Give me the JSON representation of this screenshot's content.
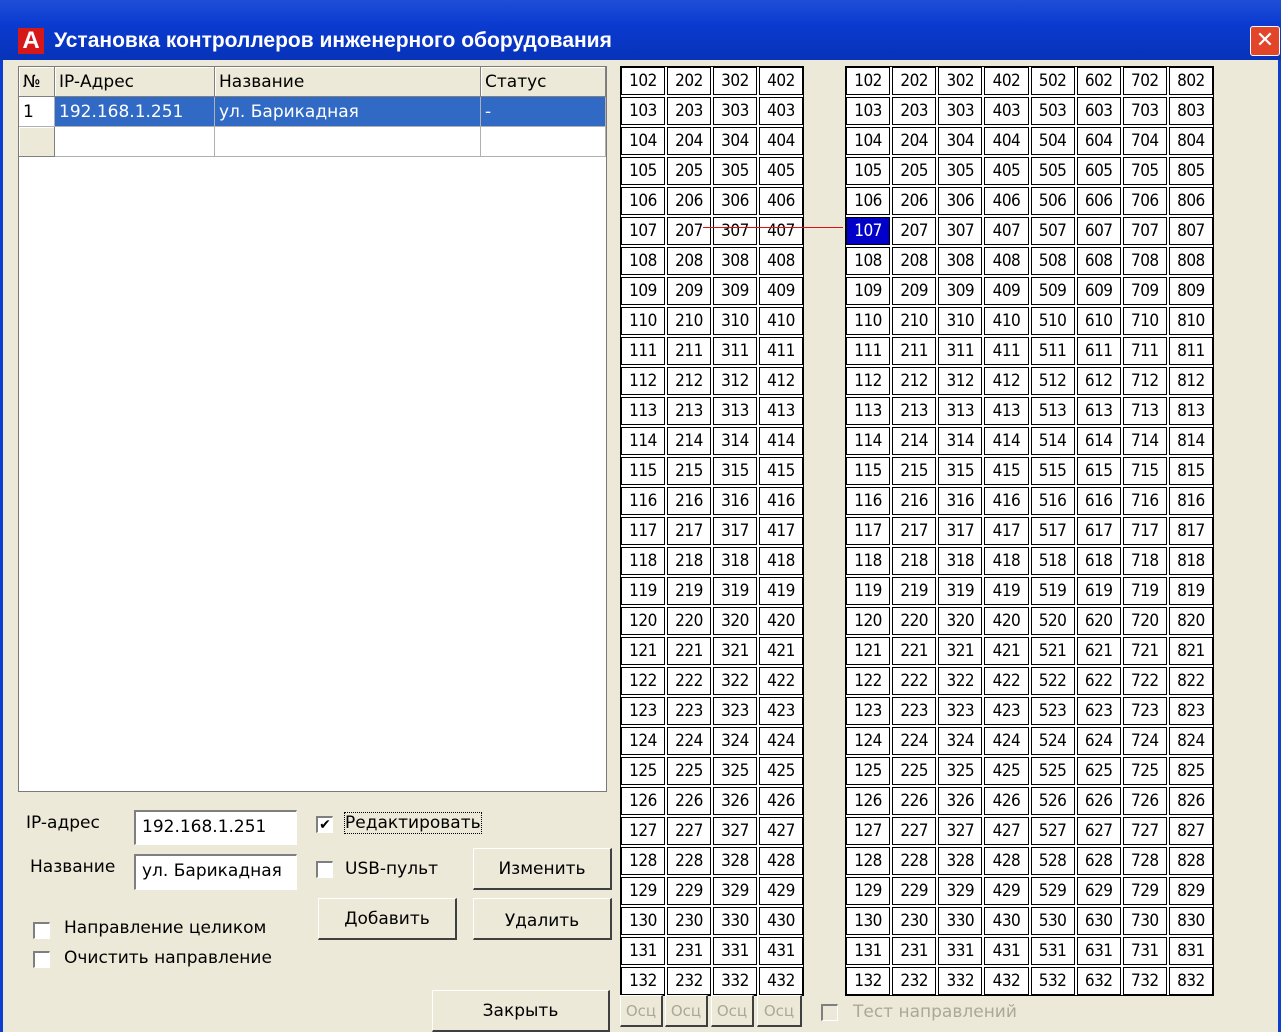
{
  "window": {
    "title": "Установка контроллеров инженерного оборудования",
    "logo_letter": "A",
    "close_glyph": "✕"
  },
  "table": {
    "columns": [
      "№",
      "IP-Адрес",
      "Название",
      "Статус"
    ],
    "rows": [
      {
        "num": "1",
        "ip": "192.168.1.251",
        "name": "ул. Барикадная",
        "status": "-"
      }
    ]
  },
  "form": {
    "ip_label": "IP-адрес",
    "ip_value": "192.168.1.251",
    "name_label": "Название",
    "name_value": "ул. Барикадная",
    "edit_label": "Редактировать",
    "edit_checked": true,
    "usb_label": "USB-пульт",
    "usb_checked": false,
    "whole_direction_label": "Направление целиком",
    "clear_direction_label": "Очистить направление",
    "change_button": "Изменить",
    "add_button": "Добавить",
    "delete_button": "Удалить",
    "close_button": "Закрыть"
  },
  "left_grid": {
    "floors": [
      1,
      2,
      3,
      4
    ],
    "rooms_from": 2,
    "rooms_to": 32
  },
  "right_grid": {
    "floors": [
      1,
      2,
      3,
      4,
      5,
      6,
      7,
      8
    ],
    "rooms_from": 2,
    "rooms_to": 32,
    "selected": "107"
  },
  "bottom": {
    "osc_buttons": [
      "Осц",
      "Осц",
      "Осц",
      "Осц"
    ],
    "test_directions_label": "Тест направлений"
  },
  "colors": {
    "selection": "#316ac5",
    "room_selected": "#0000c8",
    "link_line": "#e01010",
    "titlebar": "#0a3ad0"
  }
}
